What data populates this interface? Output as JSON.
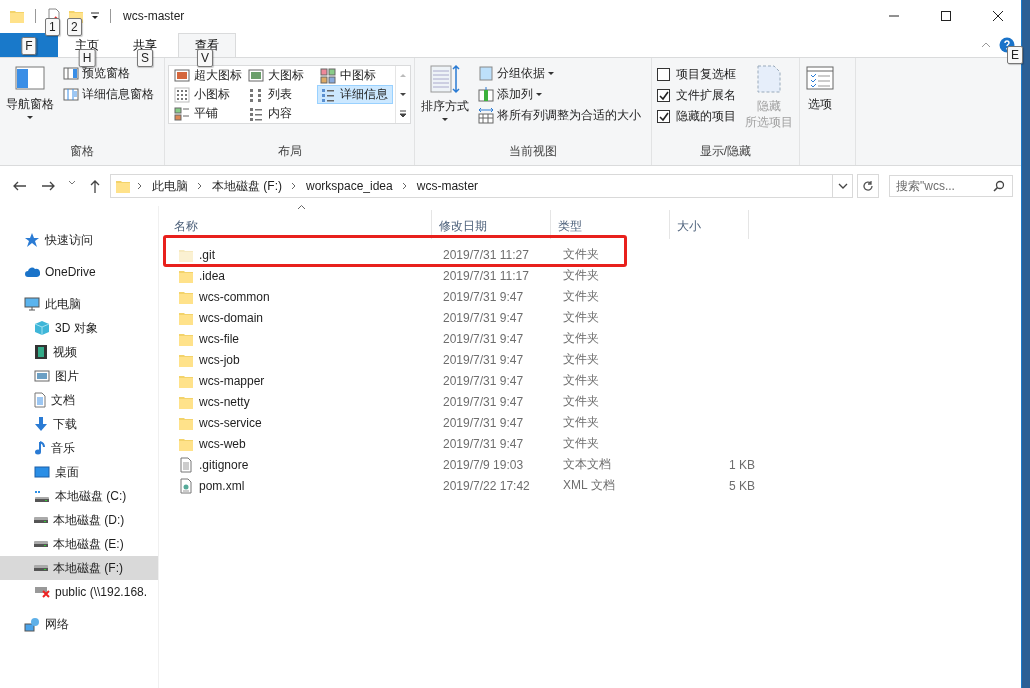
{
  "window": {
    "title": "wcs-master"
  },
  "quick_access": [
    {
      "kind": "properties",
      "keytip": "1"
    },
    {
      "kind": "newfolder",
      "keytip": "2"
    }
  ],
  "ribbon_tabs": [
    {
      "kind": "file",
      "keytip": "F",
      "selected": false
    },
    {
      "label": "主页",
      "kind": "tab",
      "keytip": "H",
      "selected": false
    },
    {
      "label": "共享",
      "kind": "tab",
      "keytip": "S",
      "selected": false
    },
    {
      "label": "查看",
      "kind": "tab",
      "keytip": "V",
      "selected": true
    }
  ],
  "help_keytip": "E",
  "ribbon_groups": [
    {
      "title": "窗格",
      "items": [
        {
          "kind": "large",
          "label_lines": [
            "导航窗格"
          ],
          "dropdown": true
        },
        {
          "kind": "stack",
          "buttons": [
            {
              "label": "预览窗格"
            },
            {
              "label": "详细信息窗格"
            }
          ]
        }
      ]
    },
    {
      "title": "布局",
      "items": [
        {
          "kind": "gallery",
          "options": [
            {
              "label": "超大图标",
              "selected": false
            },
            {
              "label": "大图标",
              "selected": false
            },
            {
              "label": "中图标",
              "selected": false
            },
            {
              "label": "小图标",
              "selected": false
            },
            {
              "label": "列表",
              "selected": false
            },
            {
              "label": "详细信息",
              "selected": true
            },
            {
              "label": "平铺",
              "selected": false
            },
            {
              "label": "内容",
              "selected": false
            }
          ]
        }
      ]
    },
    {
      "title": "当前视图",
      "items": [
        {
          "kind": "large",
          "label_lines": [
            "排序方式"
          ],
          "dropdown": true
        },
        {
          "kind": "stack",
          "buttons": [
            {
              "label": "分组依据",
              "dropdown": true
            },
            {
              "label": "添加列",
              "dropdown": true
            },
            {
              "label": "将所有列调整为合适的大小"
            }
          ]
        }
      ]
    },
    {
      "title": "显示/隐藏",
      "items": [
        {
          "kind": "checks",
          "boxes": [
            {
              "label": "项目复选框",
              "checked": false
            },
            {
              "label": "文件扩展名",
              "checked": true
            },
            {
              "label": "隐藏的项目",
              "checked": true
            }
          ]
        },
        {
          "kind": "large",
          "label_lines": [
            "隐藏",
            "所选项目"
          ],
          "disabled": true
        }
      ]
    },
    {
      "items": [
        {
          "kind": "large",
          "label_lines": [
            "选项"
          ]
        }
      ]
    }
  ],
  "address": {
    "breadcrumbs": [
      "此电脑",
      "本地磁盘 (F:)",
      "workspace_idea",
      "wcs-master"
    ],
    "search_placeholder": "搜索\"wcs..."
  },
  "navigation": [
    {
      "label": "快速访问",
      "kind": "star",
      "selected": false
    },
    {
      "label": "OneDrive",
      "kind": "cloud",
      "selected": false
    },
    {
      "label": "此电脑",
      "kind": "pc",
      "selected": false,
      "children": [
        {
          "label": "3D 对象",
          "kind": "cube",
          "selected": false
        },
        {
          "label": "视频",
          "kind": "video",
          "selected": false
        },
        {
          "label": "图片",
          "kind": "image",
          "selected": false
        },
        {
          "label": "文档",
          "kind": "doc",
          "selected": false
        },
        {
          "label": "下载",
          "kind": "download",
          "selected": false
        },
        {
          "label": "音乐",
          "kind": "music",
          "selected": false
        },
        {
          "label": "桌面",
          "kind": "desktop",
          "selected": false
        },
        {
          "label": "本地磁盘 (C:)",
          "kind": "sysdrive",
          "selected": false
        },
        {
          "label": "本地磁盘 (D:)",
          "kind": "drive",
          "selected": false
        },
        {
          "label": "本地磁盘 (E:)",
          "kind": "drive",
          "selected": false
        },
        {
          "label": "本地磁盘 (F:)",
          "kind": "drive",
          "selected": true
        },
        {
          "label": "public (\\\\192.168.",
          "kind": "netdrive",
          "selected": false
        }
      ]
    },
    {
      "label": "网络",
      "kind": "network",
      "selected": false
    }
  ],
  "table": {
    "columns": [
      {
        "label": "名称",
        "sorted": true
      },
      {
        "label": "修改日期",
        "sorted": false
      },
      {
        "label": "类型",
        "sorted": false
      },
      {
        "label": "大小",
        "sorted": false
      }
    ],
    "rows": [
      {
        "name": ".git",
        "date": "2019/7/31 11:27",
        "type": "文件夹",
        "kind": "folder",
        "hidden": true,
        "highlighted": true
      },
      {
        "name": ".idea",
        "date": "2019/7/31 11:17",
        "type": "文件夹",
        "kind": "folder",
        "hidden": false,
        "highlighted": false
      },
      {
        "name": "wcs-common",
        "date": "2019/7/31 9:47",
        "type": "文件夹",
        "kind": "folder",
        "hidden": false,
        "highlighted": false
      },
      {
        "name": "wcs-domain",
        "date": "2019/7/31 9:47",
        "type": "文件夹",
        "kind": "folder",
        "hidden": false,
        "highlighted": false
      },
      {
        "name": "wcs-file",
        "date": "2019/7/31 9:47",
        "type": "文件夹",
        "kind": "folder",
        "hidden": false,
        "highlighted": false
      },
      {
        "name": "wcs-job",
        "date": "2019/7/31 9:47",
        "type": "文件夹",
        "kind": "folder",
        "hidden": false,
        "highlighted": false
      },
      {
        "name": "wcs-mapper",
        "date": "2019/7/31 9:47",
        "type": "文件夹",
        "kind": "folder",
        "hidden": false,
        "highlighted": false
      },
      {
        "name": "wcs-netty",
        "date": "2019/7/31 9:47",
        "type": "文件夹",
        "kind": "folder",
        "hidden": false,
        "highlighted": false
      },
      {
        "name": "wcs-service",
        "date": "2019/7/31 9:47",
        "type": "文件夹",
        "kind": "folder",
        "hidden": false,
        "highlighted": false
      },
      {
        "name": "wcs-web",
        "date": "2019/7/31 9:47",
        "type": "文件夹",
        "kind": "folder",
        "hidden": false,
        "highlighted": false
      },
      {
        "name": ".gitignore",
        "date": "2019/7/9 19:03",
        "type": "文本文档",
        "size": "1 KB",
        "kind": "text",
        "hidden": false,
        "highlighted": false
      },
      {
        "name": "pom.xml",
        "date": "2019/7/22 17:42",
        "type": "XML 文档",
        "size": "5 KB",
        "kind": "xml",
        "hidden": false,
        "highlighted": false
      }
    ]
  }
}
